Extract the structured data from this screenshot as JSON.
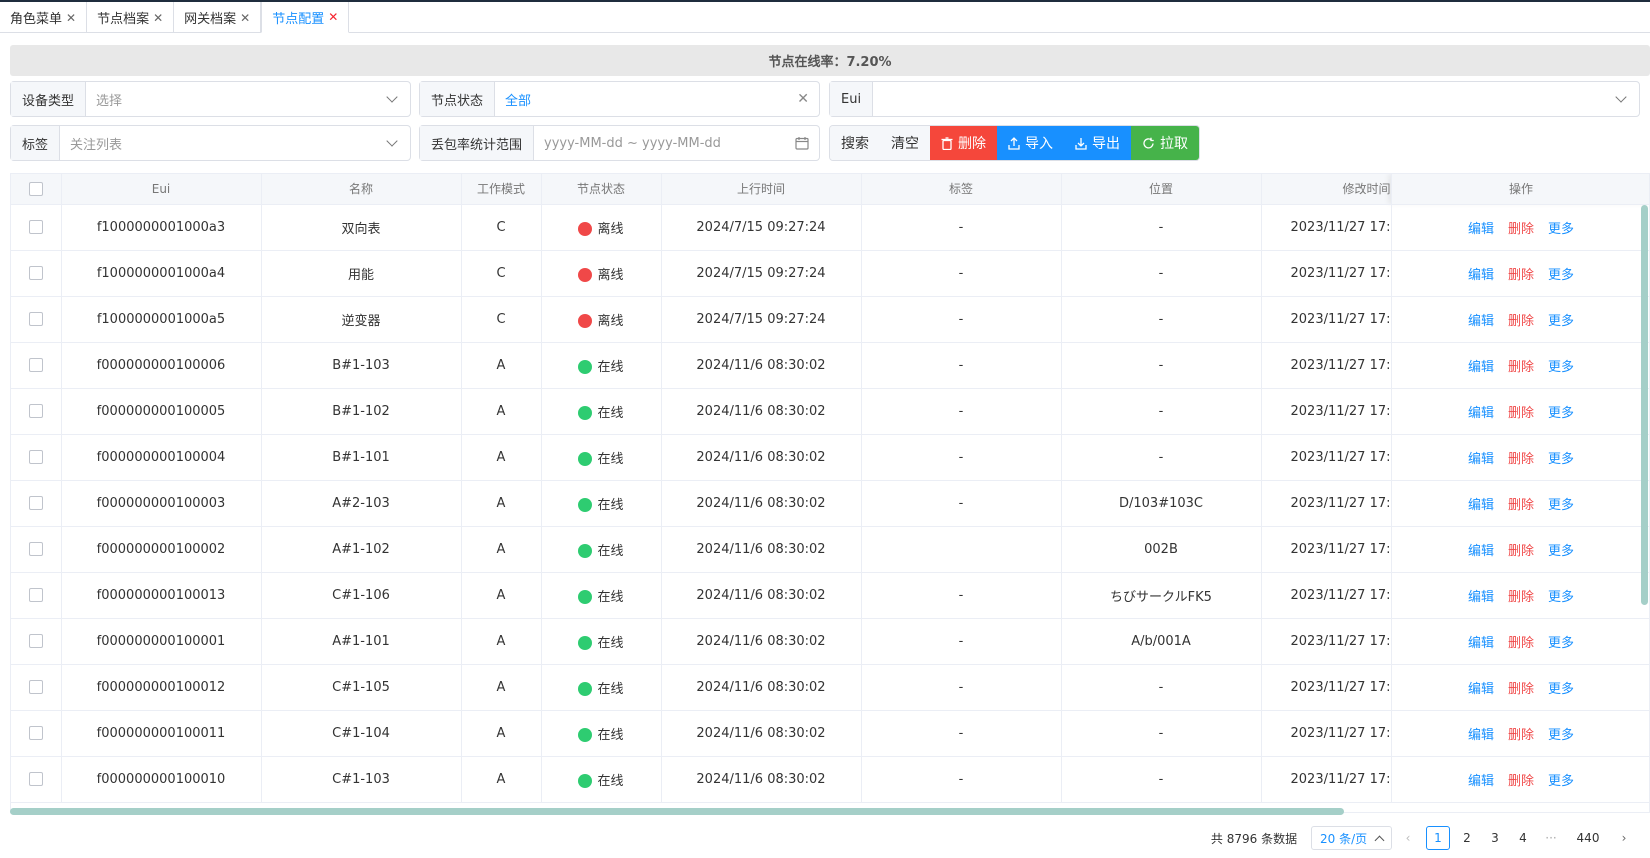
{
  "tabs": [
    {
      "label": "角色菜单",
      "active": false
    },
    {
      "label": "节点档案",
      "active": false
    },
    {
      "label": "网关档案",
      "active": false
    },
    {
      "label": "节点配置",
      "active": true
    }
  ],
  "online_rate": "节点在线率：7.20%",
  "filters": {
    "device_type": {
      "label": "设备类型",
      "placeholder": "选择"
    },
    "node_status": {
      "label": "节点状态",
      "value": "全部"
    },
    "eui": {
      "label": "Eui",
      "value": ""
    },
    "tag": {
      "label": "标签",
      "placeholder": "关注列表"
    },
    "loss_range": {
      "label": "丢包率统计范围",
      "placeholder": "yyyy-MM-dd ~ yyyy-MM-dd"
    }
  },
  "buttons": {
    "search": "搜索",
    "clear": "清空",
    "delete": "删除",
    "import": "导入",
    "export": "导出",
    "pull": "拉取"
  },
  "table": {
    "columns": [
      "Eui",
      "名称",
      "工作模式",
      "节点状态",
      "上行时间",
      "标签",
      "位置",
      "修改时间",
      "操作"
    ],
    "ops": {
      "edit": "编辑",
      "delete": "删除",
      "more": "更多"
    },
    "rows": [
      {
        "eui": "f1000000001000a3",
        "name": "双向表",
        "mode": "C",
        "status": "离线",
        "online": false,
        "uptime": "2024/7/15 09:27:24",
        "tag": "-",
        "location": "-",
        "mtime": "2023/11/27 17:"
      },
      {
        "eui": "f1000000001000a4",
        "name": "用能",
        "mode": "C",
        "status": "离线",
        "online": false,
        "uptime": "2024/7/15 09:27:24",
        "tag": "-",
        "location": "-",
        "mtime": "2023/11/27 17:"
      },
      {
        "eui": "f1000000001000a5",
        "name": "逆变器",
        "mode": "C",
        "status": "离线",
        "online": false,
        "uptime": "2024/7/15 09:27:24",
        "tag": "-",
        "location": "-",
        "mtime": "2023/11/27 17:"
      },
      {
        "eui": "f000000000100006",
        "name": "B#1-103",
        "mode": "A",
        "status": "在线",
        "online": true,
        "uptime": "2024/11/6 08:30:02",
        "tag": "-",
        "location": "-",
        "mtime": "2023/11/27 17:"
      },
      {
        "eui": "f000000000100005",
        "name": "B#1-102",
        "mode": "A",
        "status": "在线",
        "online": true,
        "uptime": "2024/11/6 08:30:02",
        "tag": "-",
        "location": "-",
        "mtime": "2023/11/27 17:"
      },
      {
        "eui": "f000000000100004",
        "name": "B#1-101",
        "mode": "A",
        "status": "在线",
        "online": true,
        "uptime": "2024/11/6 08:30:02",
        "tag": "-",
        "location": "-",
        "mtime": "2023/11/27 17:"
      },
      {
        "eui": "f000000000100003",
        "name": "A#2-103",
        "mode": "A",
        "status": "在线",
        "online": true,
        "uptime": "2024/11/6 08:30:02",
        "tag": "-",
        "location": "D/103#103C",
        "mtime": "2023/11/27 17:"
      },
      {
        "eui": "f000000000100002",
        "name": "A#1-102",
        "mode": "A",
        "status": "在线",
        "online": true,
        "uptime": "2024/11/6 08:30:02",
        "tag": "",
        "location": "002B",
        "mtime": "2023/11/27 17:"
      },
      {
        "eui": "f000000000100013",
        "name": "C#1-106",
        "mode": "A",
        "status": "在线",
        "online": true,
        "uptime": "2024/11/6 08:30:02",
        "tag": "-",
        "location": "ちびサークルFK5",
        "mtime": "2023/11/27 17:"
      },
      {
        "eui": "f000000000100001",
        "name": "A#1-101",
        "mode": "A",
        "status": "在线",
        "online": true,
        "uptime": "2024/11/6 08:30:02",
        "tag": "-",
        "location": "A/b/001A",
        "mtime": "2023/11/27 17:"
      },
      {
        "eui": "f000000000100012",
        "name": "C#1-105",
        "mode": "A",
        "status": "在线",
        "online": true,
        "uptime": "2024/11/6 08:30:02",
        "tag": "-",
        "location": "-",
        "mtime": "2023/11/27 17:"
      },
      {
        "eui": "f000000000100011",
        "name": "C#1-104",
        "mode": "A",
        "status": "在线",
        "online": true,
        "uptime": "2024/11/6 08:30:02",
        "tag": "-",
        "location": "-",
        "mtime": "2023/11/27 17:"
      },
      {
        "eui": "f000000000100010",
        "name": "C#1-103",
        "mode": "A",
        "status": "在线",
        "online": true,
        "uptime": "2024/11/6 08:30:02",
        "tag": "-",
        "location": "-",
        "mtime": "2023/11/27 17:"
      }
    ]
  },
  "pagination": {
    "total": "共 8796 条数据",
    "page_size": "20 条/页",
    "current": "1",
    "pages": [
      "2",
      "3",
      "4"
    ],
    "ellipsis": "···",
    "last": "440",
    "prev": "‹",
    "next": "›"
  }
}
